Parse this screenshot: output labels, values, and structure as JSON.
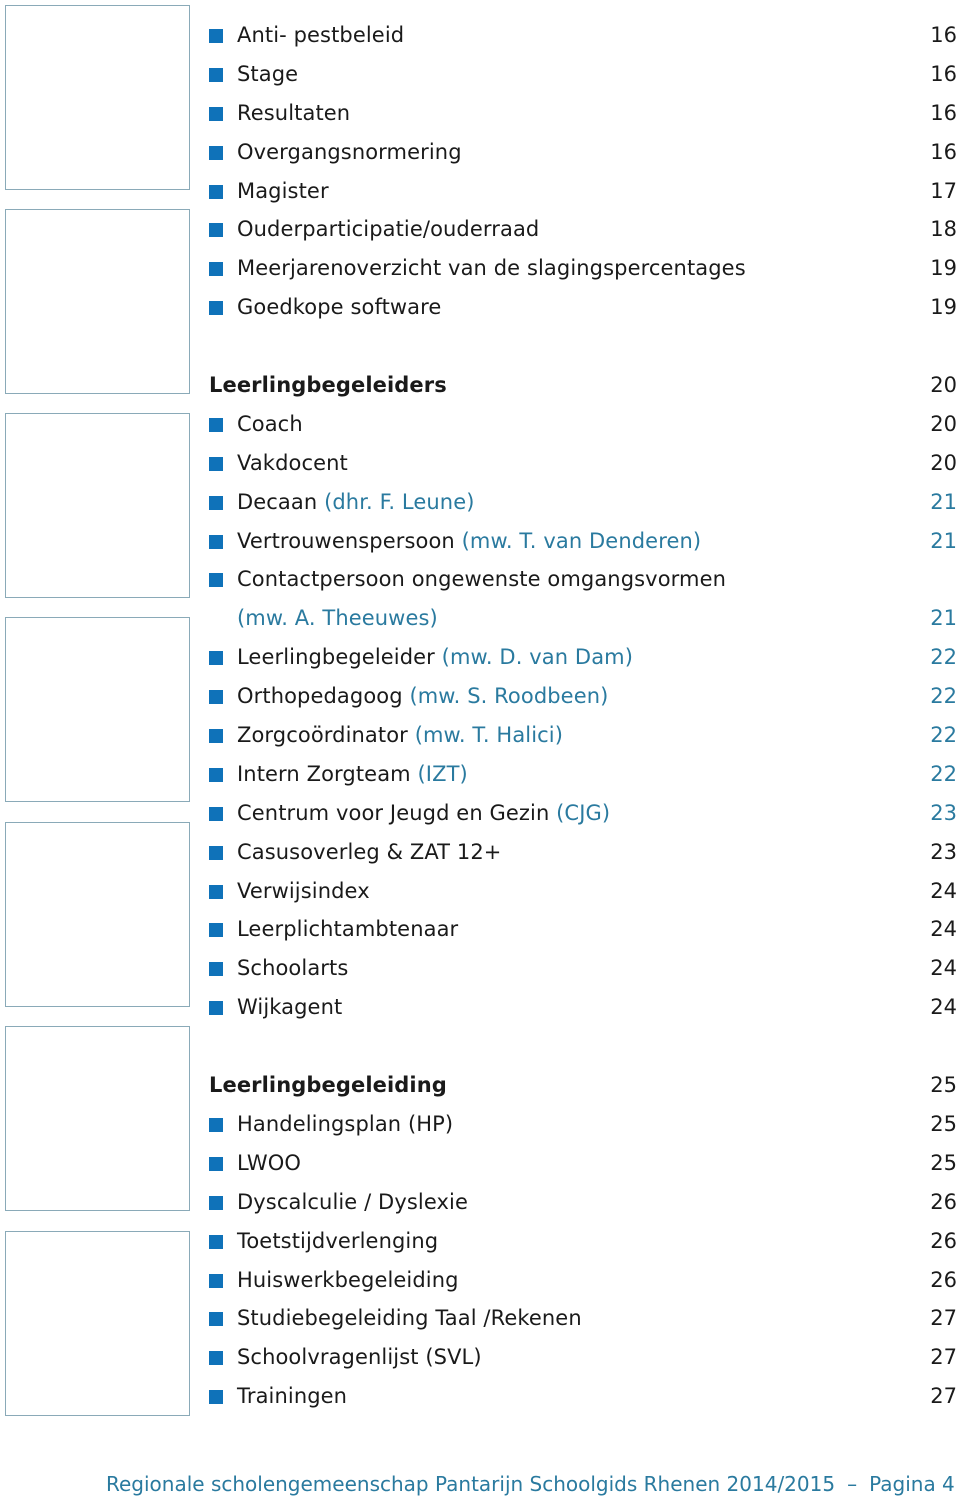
{
  "toc": [
    {
      "type": "item",
      "label": "Anti- pestbeleid",
      "note": "",
      "page": "16",
      "page_accent": false
    },
    {
      "type": "item",
      "label": "Stage",
      "note": "",
      "page": "16",
      "page_accent": false
    },
    {
      "type": "item",
      "label": "Resultaten",
      "note": "",
      "page": "16",
      "page_accent": false
    },
    {
      "type": "item",
      "label": "Overgangsnormering",
      "note": "",
      "page": "16",
      "page_accent": false
    },
    {
      "type": "item",
      "label": "Magister",
      "note": "",
      "page": "17",
      "page_accent": false
    },
    {
      "type": "item",
      "label": "Ouderparticipatie/ouderraad",
      "note": "",
      "page": "18",
      "page_accent": false
    },
    {
      "type": "item",
      "label": "Meerjarenoverzicht van de slagingspercentages",
      "note": "",
      "page": "19",
      "page_accent": false
    },
    {
      "type": "item",
      "label": "Goedkope software",
      "note": "",
      "page": "19",
      "page_accent": false
    },
    {
      "type": "heading",
      "label": "Leerlingbegeleiders",
      "note": "",
      "page": "20",
      "page_accent": false,
      "gap": true
    },
    {
      "type": "item",
      "label": "Coach",
      "note": "",
      "page": "20",
      "page_accent": false
    },
    {
      "type": "item",
      "label": "Vakdocent",
      "note": "",
      "page": "20",
      "page_accent": false
    },
    {
      "type": "item",
      "label": "Decaan",
      "note": "(dhr. F. Leune)",
      "page": "21",
      "page_accent": true
    },
    {
      "type": "item",
      "label": "Vertrouwenspersoon",
      "note": "(mw. T. van Denderen)",
      "page": "21",
      "page_accent": true
    },
    {
      "type": "item",
      "label": "Contactpersoon ongewenste omgangsvormen",
      "note": "",
      "page": "",
      "page_accent": false
    },
    {
      "type": "continuation",
      "label": "",
      "note": "(mw. A. Theeuwes)",
      "page": "21",
      "page_accent": true
    },
    {
      "type": "item",
      "label": "Leerlingbegeleider",
      "note": "(mw. D. van Dam)",
      "page": "22",
      "page_accent": true
    },
    {
      "type": "item",
      "label": "Orthopedagoog",
      "note": "(mw. S. Roodbeen)",
      "page": "22",
      "page_accent": true
    },
    {
      "type": "item",
      "label": "Zorgcoördinator",
      "note": "(mw. T. Halici)",
      "page": "22",
      "page_accent": true
    },
    {
      "type": "item",
      "label": "Intern Zorgteam",
      "note": "(IZT)",
      "page": "22",
      "page_accent": true
    },
    {
      "type": "item",
      "label": "Centrum voor Jeugd en Gezin",
      "note": "(CJG)",
      "page": "23",
      "page_accent": true
    },
    {
      "type": "item",
      "label": "Casusoverleg & ZAT 12+",
      "note": "",
      "page": "23",
      "page_accent": false
    },
    {
      "type": "item",
      "label": "Verwijsindex",
      "note": "",
      "page": "24",
      "page_accent": false
    },
    {
      "type": "item",
      "label": "Leerplichtambtenaar",
      "note": "",
      "page": "24",
      "page_accent": false
    },
    {
      "type": "item",
      "label": "Schoolarts",
      "note": "",
      "page": "24",
      "page_accent": false
    },
    {
      "type": "item",
      "label": "Wijkagent",
      "note": "",
      "page": "24",
      "page_accent": false
    },
    {
      "type": "heading",
      "label": "Leerlingbegeleiding",
      "note": "",
      "page": "25",
      "page_accent": false,
      "gap": true
    },
    {
      "type": "item",
      "label": "Handelingsplan (HP)",
      "note": "",
      "page": "25",
      "page_accent": false
    },
    {
      "type": "item",
      "label": "LWOO",
      "note": "",
      "page": "25",
      "page_accent": false
    },
    {
      "type": "item",
      "label": "Dyscalculie / Dyslexie",
      "note": "",
      "page": "26",
      "page_accent": false
    },
    {
      "type": "item",
      "label": "Toetstijdverlenging",
      "note": "",
      "page": "26",
      "page_accent": false
    },
    {
      "type": "item",
      "label": "Huiswerkbegeleiding",
      "note": "",
      "page": "26",
      "page_accent": false
    },
    {
      "type": "item",
      "label": "Studiebegeleiding Taal /Rekenen",
      "note": "",
      "page": "27",
      "page_accent": false
    },
    {
      "type": "item",
      "label": "Schoolvragenlijst (SVL)",
      "note": "",
      "page": "27",
      "page_accent": false
    },
    {
      "type": "item",
      "label": "Trainingen",
      "note": "",
      "page": "27",
      "page_accent": false
    }
  ],
  "footer": {
    "title": "Regionale scholengemeenschap Pantarijn Schoolgids Rhenen 2014/2015",
    "separator": "–",
    "page_label": "Pagina 4"
  },
  "colors": {
    "bullet": "#0f72b9",
    "accent_text": "#2a7a9f",
    "box_border": "#8aaab8"
  }
}
